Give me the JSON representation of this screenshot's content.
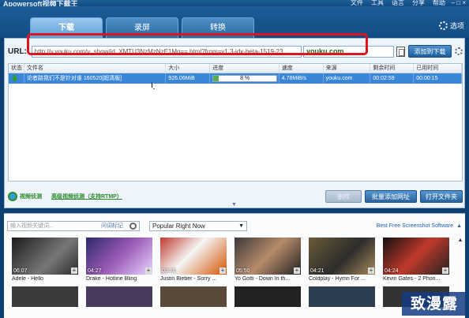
{
  "titlebar": {
    "app_title": "Apowersoft视频下载王",
    "menus": [
      "文件",
      "工具",
      "语言",
      "分享",
      "帮助"
    ],
    "window_controls": "– □ ×"
  },
  "tabs": [
    {
      "label": "下载",
      "active": true
    },
    {
      "label": "录屏",
      "active": false
    },
    {
      "label": "转换",
      "active": false
    }
  ],
  "options_label": "选项",
  "url_bar": {
    "label": "URL:",
    "value": "http://v.youku.com/v_show/id_XMTU3NzMzNzE1Mg==.html?from=y1.3-idx-beta-1519-23",
    "site": "youku.com",
    "add_button": "添加到下载"
  },
  "table": {
    "headers": [
      "状态",
      "文件名",
      "大小",
      "进度",
      "速度",
      "来源",
      "剩余时间",
      "已用时间"
    ],
    "rows": [
      {
        "name": "论者路我们不是针对谁 160520[超清版]",
        "size": "926.06MiB",
        "progress_text": "8 %",
        "progress_value": 0.08,
        "speed": "4.78MiB/s",
        "source": "youku.com",
        "remaining": "00:02:59",
        "elapsed": "00:00:15"
      }
    ]
  },
  "bottom": {
    "video_detect": "视频侦测",
    "advanced_detect": "高级视频侦测（支持RTMP）",
    "buttons": [
      "删除",
      "批量添加网址",
      "打开文件夹"
    ]
  },
  "browser": {
    "search_placeholder": "输入视频关键词...",
    "tag_label": "问词标记",
    "category": "Popular Right Now",
    "ad_link": "Best Free Screenshot Software",
    "videos": [
      {
        "title": "Adele - Hello",
        "duration": "06:07"
      },
      {
        "title": "Drake - Hotline Bling",
        "duration": "04:27"
      },
      {
        "title": "Justin Bieber - Sorry ...",
        "duration": "03:26"
      },
      {
        "title": "Yo Gotti - Down In th...",
        "duration": "05:50"
      },
      {
        "title": "Coldplay - Hymn For ...",
        "duration": "04:21"
      },
      {
        "title": "Kevin Gates - 2 Phon...",
        "duration": "04:24"
      }
    ]
  },
  "watermark": "致漫露",
  "colors": {
    "header": "#134c83",
    "selected_row": "#3a86d8",
    "highlight_box": "#e0141e",
    "progress_fill": "#55b04a"
  }
}
